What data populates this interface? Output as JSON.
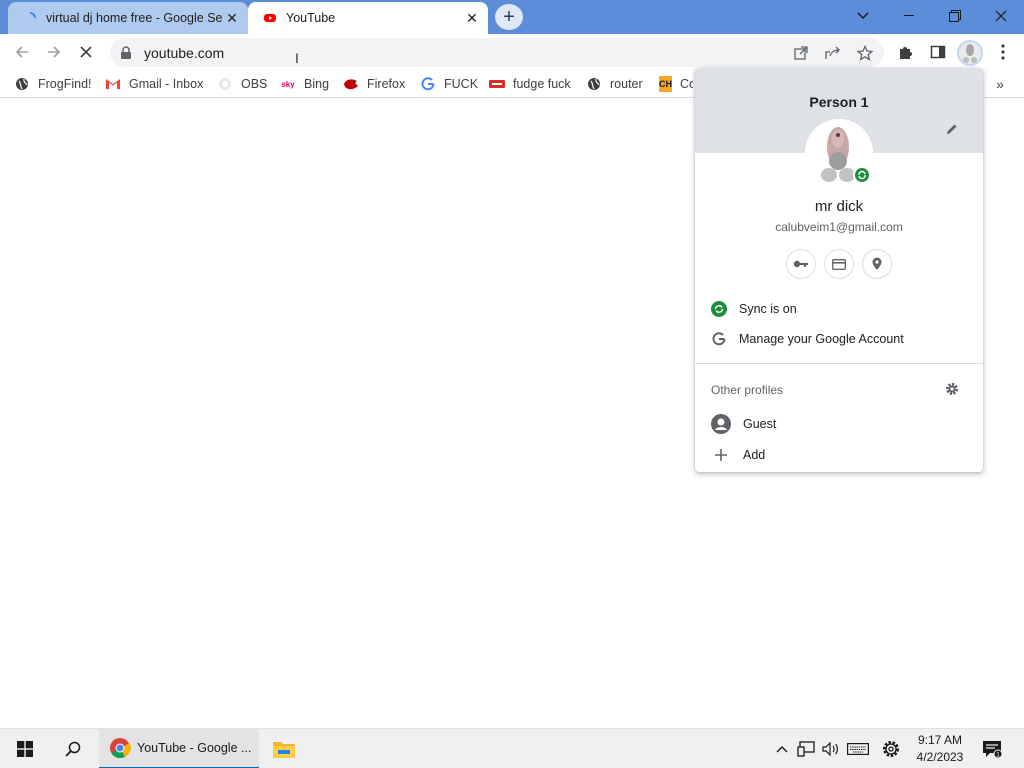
{
  "tabs": [
    {
      "title": "virtual dj home free - Google Se",
      "state": "inactive"
    },
    {
      "title": "YouTube",
      "state": "active"
    }
  ],
  "window_controls": {
    "dropdown": "chevron-down-icon",
    "minimize": "minimize-icon",
    "restore": "restore-icon",
    "close": "close-icon"
  },
  "toolbar": {
    "url": "youtube.com"
  },
  "bookmarks": [
    {
      "label": "FrogFind!",
      "icon": "globe-icon"
    },
    {
      "label": "Gmail - Inbox",
      "icon": "gmail-icon"
    },
    {
      "label": "OBS",
      "icon": "github-icon"
    },
    {
      "label": "Bing",
      "icon": "sky-icon"
    },
    {
      "label": "Firefox",
      "icon": "firefox-icon"
    },
    {
      "label": "FUCK",
      "icon": "google-icon"
    },
    {
      "label": "fudge fuck",
      "icon": "bookmark-icon"
    },
    {
      "label": "router",
      "icon": "globe-icon"
    },
    {
      "label": "Co",
      "icon": "ch-icon"
    }
  ],
  "profile_menu": {
    "profile_name": "Person 1",
    "display_name": "mr dick",
    "email": "calubveim1@gmail.com",
    "sync_label": "Sync is on",
    "manage_label": "Manage your Google Account",
    "other_profiles_label": "Other profiles",
    "guest_label": "Guest",
    "add_label": "Add"
  },
  "taskbar": {
    "chrome_label": "YouTube - Google ...",
    "time": "9:17 AM",
    "date": "4/2/2023"
  },
  "colors": {
    "tabstrip": "#5b8dd8",
    "sync_green": "#1e8e3e",
    "taskbar_accent": "#0067c0"
  }
}
